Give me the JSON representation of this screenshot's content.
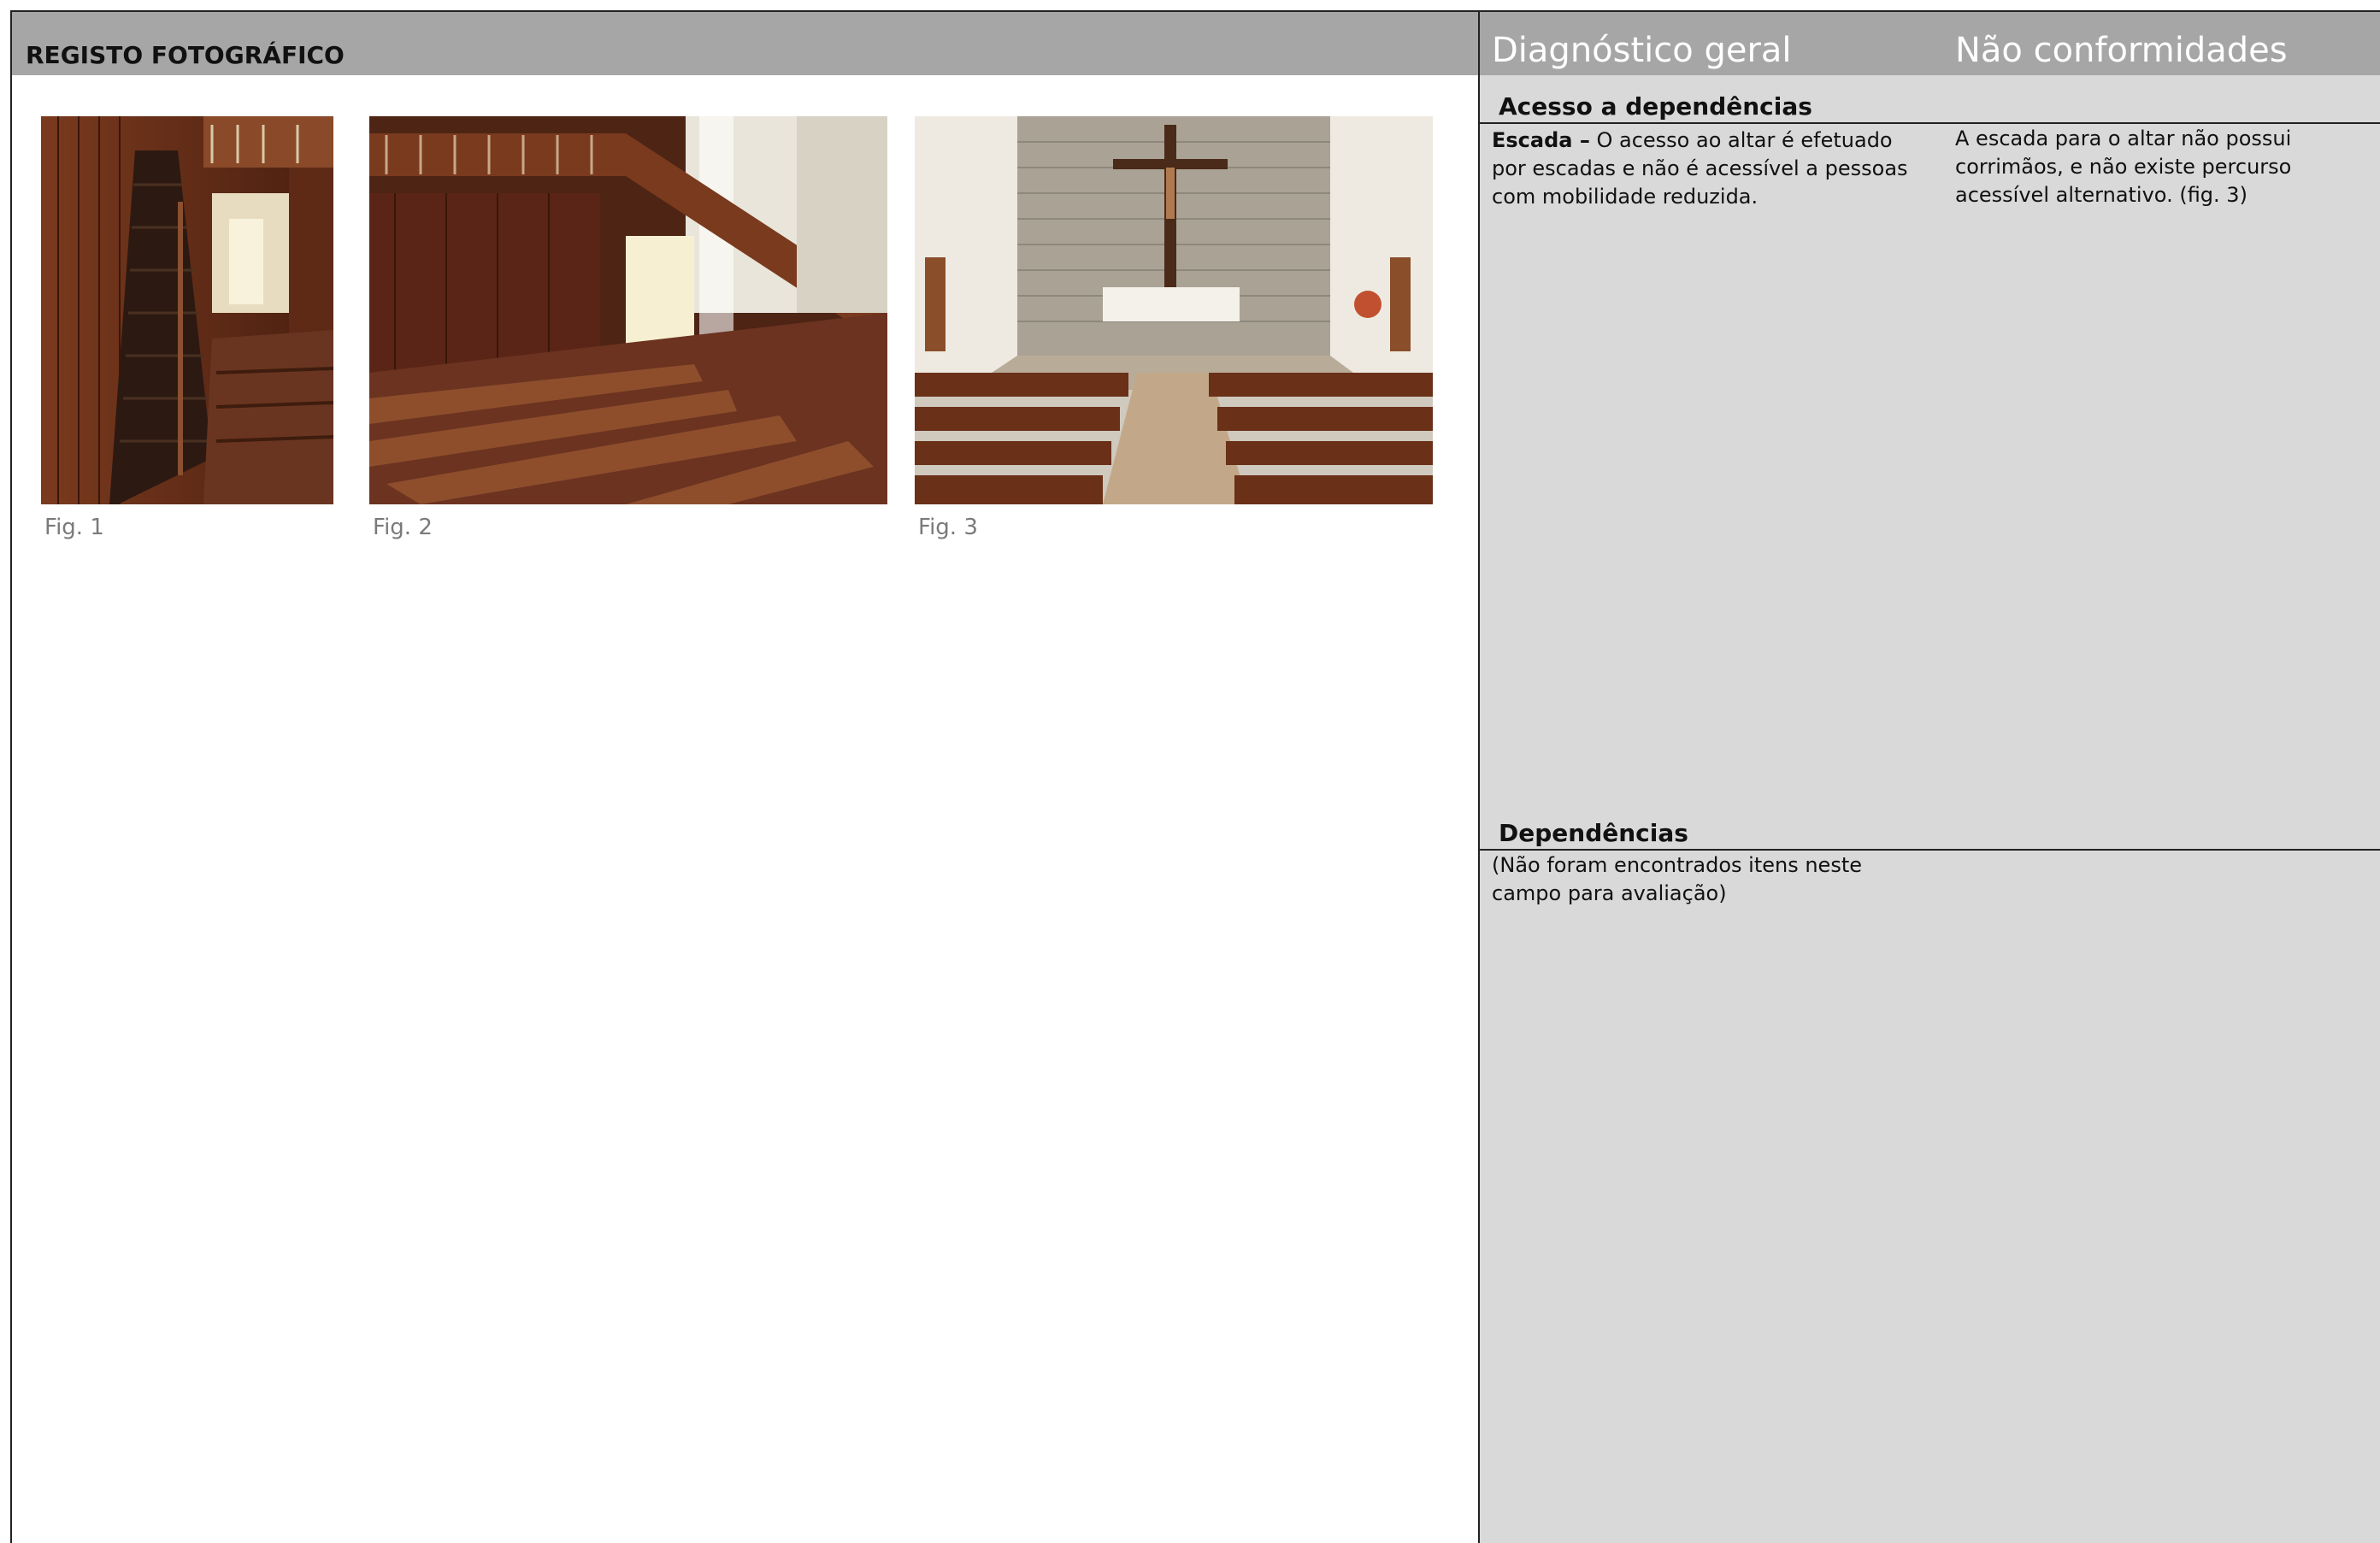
{
  "left": {
    "header": "REGISTO FOTOGRÁFICO",
    "figures": [
      {
        "caption": "Fig. 1",
        "subject": "staircase"
      },
      {
        "caption": "Fig. 2",
        "subject": "nave-balcony"
      },
      {
        "caption": "Fig. 3",
        "subject": "altar"
      }
    ]
  },
  "right": {
    "col1_title": "Diagnóstico geral",
    "col2_title": "Não conformidades",
    "sections": [
      {
        "title": "Acesso a dependências",
        "item_label": "Escada –",
        "item_text": " O acesso ao altar é efetuado por escadas e não é acessível a pessoas com mobilidade reduzida.",
        "nonconformity": "A escada para o altar não possui corrimãos, e não existe percurso acessível alternativo. (fig. 3)"
      },
      {
        "title": "Dependências",
        "item_text": "(Não foram encontrados itens neste campo para avaliação)"
      }
    ]
  },
  "colors": {
    "header_bg": "#a6a6a6",
    "panel_bg": "#d9d9d9",
    "caption": "#7a7a7a"
  }
}
